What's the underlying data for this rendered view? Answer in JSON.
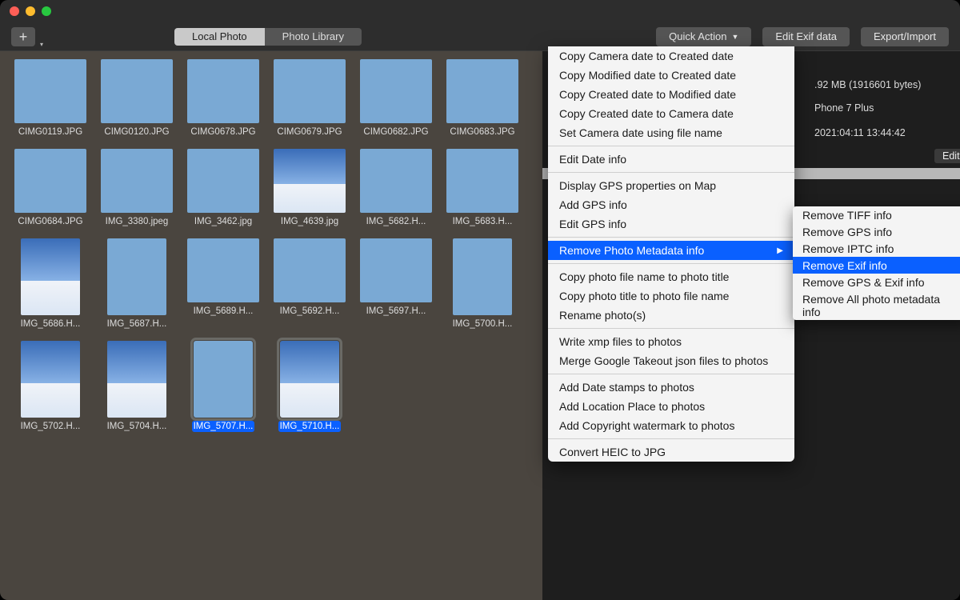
{
  "toolbar": {
    "tab_local": "Local Photo",
    "tab_library": "Photo Library",
    "quick_action": "Quick Action",
    "edit_exif": "Edit Exif data",
    "export_import": "Export/Import"
  },
  "thumbnails": [
    {
      "label": "CIMG0119.JPG",
      "orient": "l",
      "style": "pillars"
    },
    {
      "label": "CIMG0120.JPG",
      "orient": "l",
      "style": "pillars"
    },
    {
      "label": "CIMG0678.JPG",
      "orient": "l",
      "style": "pillars"
    },
    {
      "label": "CIMG0679.JPG",
      "orient": "l",
      "style": "pillars"
    },
    {
      "label": "CIMG0682.JPG",
      "orient": "l",
      "style": "roof"
    },
    {
      "label": "CIMG0683.JPG",
      "orient": "l",
      "style": "roof"
    },
    {
      "label": "CIMG0684.JPG",
      "orient": "l",
      "style": "sky"
    },
    {
      "label": "IMG_3380.jpeg",
      "orient": "l",
      "style": "sky"
    },
    {
      "label": "IMG_3462.jpg",
      "orient": "l",
      "style": "sky"
    },
    {
      "label": "IMG_4639.jpg",
      "orient": "l",
      "style": "clouds"
    },
    {
      "label": "IMG_5682.H...",
      "orient": "l",
      "style": "sky"
    },
    {
      "label": "IMG_5683.H...",
      "orient": "l",
      "style": "sky"
    },
    {
      "label": "IMG_5686.H...",
      "orient": "p",
      "style": "clouds"
    },
    {
      "label": "IMG_5687.H...",
      "orient": "p",
      "style": "sky"
    },
    {
      "label": "IMG_5689.H...",
      "orient": "l",
      "style": "sky"
    },
    {
      "label": "IMG_5692.H...",
      "orient": "l",
      "style": "sky"
    },
    {
      "label": "IMG_5697.H...",
      "orient": "l",
      "style": "sky"
    },
    {
      "label": "IMG_5700.H...",
      "orient": "p",
      "style": "sky"
    },
    {
      "label": "IMG_5702.H...",
      "orient": "p",
      "style": "clouds"
    },
    {
      "label": "IMG_5704.H...",
      "orient": "p",
      "style": "clouds"
    },
    {
      "label": "IMG_5707.H...",
      "orient": "p",
      "style": "sky",
      "selected": true
    },
    {
      "label": "IMG_5710.H...",
      "orient": "p",
      "style": "clouds",
      "selected": true
    }
  ],
  "info": {
    "size": ".92 MB (1916601 bytes)",
    "device": "Phone 7 Plus",
    "date": "2021:04:11 13:44:42",
    "edit": "Edit"
  },
  "menu": {
    "groups": [
      [
        "Copy Camera date to Created date",
        "Copy Modified date to Created date",
        "Copy Created date to Modified date",
        "Copy Created date to Camera date",
        "Set Camera date using file name"
      ],
      [
        "Edit Date info"
      ],
      [
        "Display GPS properties on Map",
        "Add GPS info",
        "Edit GPS  info"
      ],
      [
        {
          "label": "Remove Photo Metadata info",
          "submenu": true,
          "highlight": true
        }
      ],
      [
        "Copy photo file name to photo title",
        "Copy photo title to photo file name",
        "Rename photo(s)"
      ],
      [
        "Write xmp files to photos",
        "Merge Google Takeout json files to photos"
      ],
      [
        "Add Date stamps to photos",
        "Add Location Place to photos",
        "Add Copyright watermark to photos"
      ],
      [
        "Convert HEIC to JPG"
      ]
    ]
  },
  "submenu": [
    {
      "label": "Remove TIFF info"
    },
    {
      "label": "Remove GPS info"
    },
    {
      "label": "Remove IPTC info"
    },
    {
      "label": "Remove Exif info",
      "highlight": true
    },
    {
      "label": "Remove GPS & Exif info"
    },
    {
      "label": "Remove All photo metadata info"
    }
  ]
}
